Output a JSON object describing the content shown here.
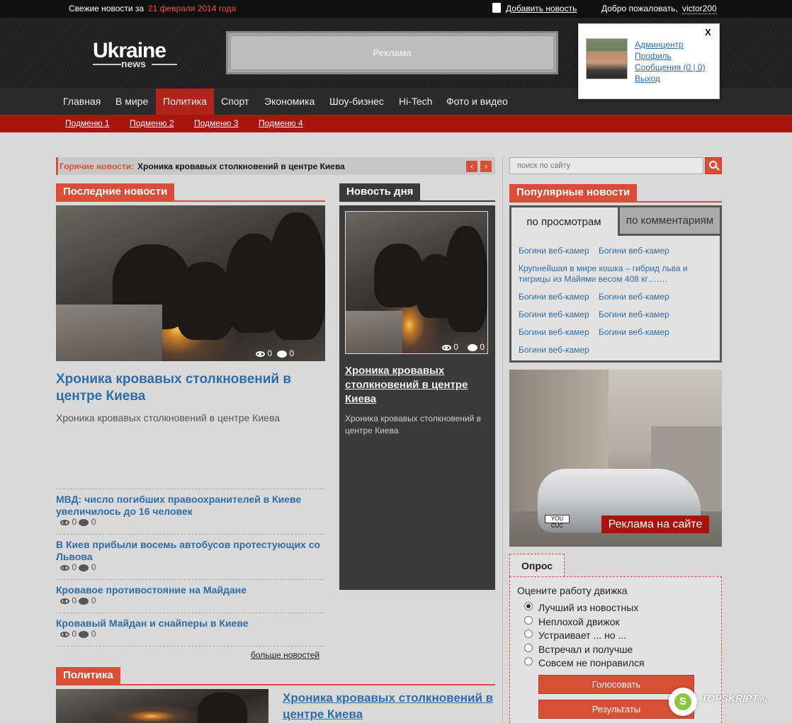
{
  "topbar": {
    "fresh_prefix": "Свежие новости за",
    "fresh_date": "21 февраля 2014 года",
    "add_news": "Добавить новость",
    "welcome": "Добро пожаловать,",
    "username": "victor200"
  },
  "header": {
    "logo_main": "Ukraine",
    "logo_sub": "news",
    "ad_label": "Реклама"
  },
  "user_popup": {
    "close": "X",
    "links": [
      "Админцентр",
      "Профиль",
      "Сообщения (0 | 0)",
      "Выход"
    ]
  },
  "nav": {
    "items": [
      "Главная",
      "В мире",
      "Политика",
      "Спорт",
      "Экономика",
      "Шоу-бизнес",
      "Hi-Tech",
      "Фото и видео"
    ],
    "active": "Политика"
  },
  "subnav": {
    "items": [
      "Подменю 1",
      "Подменю 2",
      "Подменю 3",
      "Подменю 4"
    ]
  },
  "hot_news": {
    "label": "Горячие новости:",
    "text": "Хроника кровавых столкновений в центре Киева",
    "prev": "‹",
    "next": "›"
  },
  "latest": {
    "title": "Последние новости",
    "main": {
      "views": "0",
      "comments": "0",
      "headline": "Хроника кровавых столкновений в центре Киева",
      "summary": "Хроника кровавых столкновений в центре Киева"
    },
    "items": [
      {
        "title": "МВД: число погибших правоохранителей в Киеве увеличилось до 16 человек",
        "views": "0",
        "comments": "0"
      },
      {
        "title": "В Киев прибыли восемь автобусов протестующих со Львова",
        "views": "0",
        "comments": "0"
      },
      {
        "title": "Кровавое противостояние на Майдане",
        "views": "0",
        "comments": "0"
      },
      {
        "title": "Кровавый Майдан и снайперы в Киеве",
        "views": "0",
        "comments": "0"
      }
    ],
    "more": "больше новостей"
  },
  "news_of_day": {
    "title": "Новость дня",
    "views": "0",
    "comments": "0",
    "headline": "Хроника кровавых столкновений в центре Киева",
    "summary": "Хроника кровавых столкновений в центре Киева"
  },
  "politics": {
    "title": "Политика",
    "headline": "Хроника кровавых столкновений в центре Киева"
  },
  "search": {
    "placeholder": "поиск по сайту"
  },
  "popular": {
    "title": "Популярные новости",
    "tabs": [
      "по просмотрам",
      "по комментариям"
    ],
    "rows": [
      [
        "Богини веб-камер",
        "Богини веб-камер"
      ],
      [
        "Крупнейшая в мире кошка – гибрид льва и тигрицы из Майями весом 408 кг……."
      ],
      [
        "Богини веб-камер",
        "Богини веб-камер"
      ],
      [
        "Богини веб-камер",
        "Богини веб-камер"
      ],
      [
        "Богини веб-камер",
        "Богини веб-камер"
      ],
      [
        "Богини веб-камер"
      ]
    ]
  },
  "ad_block": {
    "label": "Реклама на сайте",
    "plate": "YOU CUC"
  },
  "poll": {
    "tab": "Опрос",
    "question": "Оцените работу движка",
    "options": [
      "Лучший из новостных",
      "Неплохой движок",
      "Устраивает ... но ...",
      "Встречал и получше",
      "Совсем не понравился"
    ],
    "selected": 0,
    "vote": "Голосовать",
    "results": "Результаты"
  },
  "watermark": {
    "text": "TOPSKRIPT",
    "suffix": ".ru"
  },
  "colors": {
    "accent": "#d94e37",
    "nav_active": "#b0221a",
    "subnav": "#a8140e",
    "link": "#2e6da8"
  }
}
